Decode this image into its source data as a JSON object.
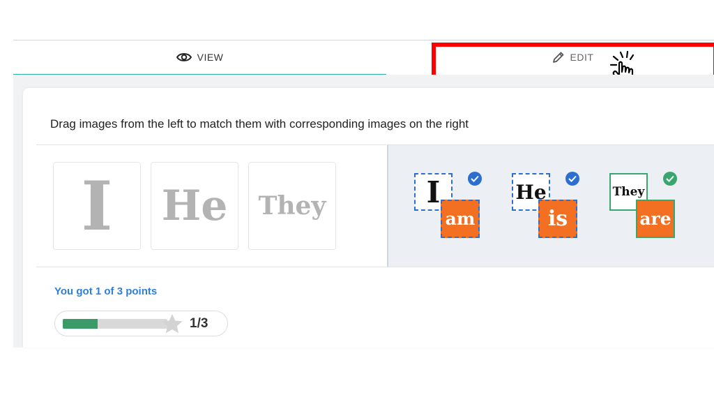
{
  "tabs": {
    "view_label": "VIEW",
    "edit_label": "EDIT"
  },
  "instruction": "Drag images from the left to match them with corresponding images on the right",
  "source_words": [
    "I",
    "He",
    "They"
  ],
  "targets": [
    {
      "word": "I",
      "verb": "am",
      "status": "checked",
      "badge_color": "#2d6fcf"
    },
    {
      "word": "He",
      "verb": "is",
      "status": "checked",
      "badge_color": "#2d6fcf"
    },
    {
      "word": "They",
      "verb": "are",
      "status": "correct",
      "badge_color": "#3aa56e"
    }
  ],
  "score": {
    "text": "You got 1 of 3 points",
    "progress": 0.333,
    "label": "1/3"
  },
  "colors": {
    "accent_tab": "#2bb3a0",
    "highlight": "#ff0000",
    "verb_card": "#f36f21",
    "score_text": "#2f7fd6",
    "progress_fill": "#3a9a68"
  },
  "icons": {
    "view": "eye-icon",
    "edit": "pencil-icon",
    "cursor": "hand-pointer-icon",
    "check": "check-circle-icon",
    "star": "star-icon"
  }
}
